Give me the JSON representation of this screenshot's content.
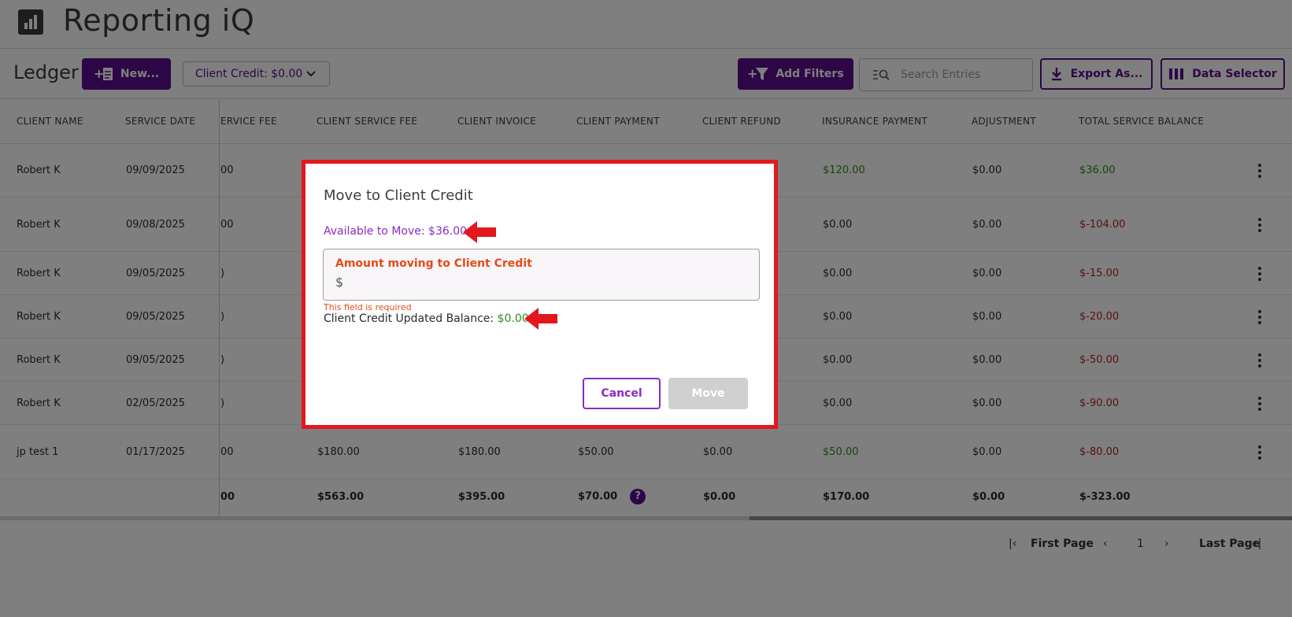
{
  "app": {
    "title": "Reporting iQ"
  },
  "toolbar": {
    "page_title": "Ledger",
    "new_label": "New...",
    "client_credit_label": "Client Credit: $0.00",
    "add_filters_label": "Add Filters",
    "search_placeholder": "Search Entries",
    "export_label": "Export As...",
    "data_selector_label": "Data Selector"
  },
  "table": {
    "columns": {
      "client_name": "CLIENT NAME",
      "service_date": "SERVICE DATE",
      "service_fee": "ERVICE FEE",
      "client_service_fee": "CLIENT SERVICE FEE",
      "client_invoice": "CLIENT INVOICE",
      "client_payment": "CLIENT PAYMENT",
      "client_refund": "CLIENT REFUND",
      "insurance_payment": "INSURANCE PAYMENT",
      "adjustment": "ADJUSTMENT",
      "total_service_balance": "TOTAL SERVICE BALANCE"
    },
    "rows": [
      {
        "client_name": "Robert K",
        "service_date": "09/09/2025",
        "service_fee": "00",
        "client_service_fee": "",
        "client_invoice": "",
        "client_payment": "",
        "client_refund": "",
        "insurance_payment": "$120.00",
        "adjustment": "$0.00",
        "total_service_balance": "$36.00"
      },
      {
        "client_name": "Robert K",
        "service_date": "09/08/2025",
        "service_fee": "00",
        "client_service_fee": "",
        "client_invoice": "",
        "client_payment": "",
        "client_refund": "",
        "insurance_payment": "$0.00",
        "adjustment": "$0.00",
        "total_service_balance": "$-104.00"
      },
      {
        "client_name": "Robert K",
        "service_date": "09/05/2025",
        "service_fee": ")",
        "client_service_fee": "",
        "client_invoice": "",
        "client_payment": "",
        "client_refund": "",
        "insurance_payment": "$0.00",
        "adjustment": "$0.00",
        "total_service_balance": "$-15.00"
      },
      {
        "client_name": "Robert K",
        "service_date": "09/05/2025",
        "service_fee": ")",
        "client_service_fee": "",
        "client_invoice": "",
        "client_payment": "",
        "client_refund": "",
        "insurance_payment": "$0.00",
        "adjustment": "$0.00",
        "total_service_balance": "$-20.00"
      },
      {
        "client_name": "Robert K",
        "service_date": "09/05/2025",
        "service_fee": ")",
        "client_service_fee": "",
        "client_invoice": "",
        "client_payment": "",
        "client_refund": "",
        "insurance_payment": "$0.00",
        "adjustment": "$0.00",
        "total_service_balance": "$-50.00"
      },
      {
        "client_name": "Robert K",
        "service_date": "02/05/2025",
        "service_fee": ")",
        "client_service_fee": "",
        "client_invoice": "",
        "client_payment": "",
        "client_refund": "",
        "insurance_payment": "$0.00",
        "adjustment": "$0.00",
        "total_service_balance": "$-90.00"
      },
      {
        "client_name": "jp test 1",
        "service_date": "01/17/2025",
        "service_fee": "00",
        "client_service_fee": "$180.00",
        "client_invoice": "$180.00",
        "client_payment": "$50.00",
        "client_refund": "$0.00",
        "insurance_payment": "$50.00",
        "adjustment": "$0.00",
        "total_service_balance": "$-80.00"
      }
    ],
    "totals": {
      "service_fee": "00",
      "client_service_fee": "$563.00",
      "client_invoice": "$395.00",
      "client_payment": "$70.00",
      "help_icon": "?",
      "client_refund": "$0.00",
      "insurance_payment": "$170.00",
      "adjustment": "$0.00",
      "total_service_balance": "$-323.00"
    }
  },
  "pagination": {
    "first_label": "First Page",
    "current_page": "1",
    "last_label": "Last Page"
  },
  "modal": {
    "title": "Move to Client Credit",
    "available_label": "Available to Move: $36.00",
    "amount_label": "Amount moving to Client Credit",
    "currency_prefix": "$",
    "amount_value": "",
    "error_text": "This field is required",
    "updated_balance_label": "Client Credit Updated Balance:",
    "updated_balance_value": "$0.00",
    "cancel_label": "Cancel",
    "move_label": "Move"
  },
  "colors": {
    "brand_purple": "#5b0f8a",
    "annotation_red": "#e3171e",
    "positive_green": "#2e8b1f",
    "negative_red": "#b22222",
    "error_orange": "#e64a19"
  },
  "icons": {
    "logo": "bar-chart-icon",
    "new": "add-document-icon",
    "filter": "add-filter-icon",
    "search": "list-search-icon",
    "export": "download-icon",
    "data_selector": "columns-icon",
    "row_menu": "kebab-menu-icon",
    "annotation": "red-arrow-icon"
  }
}
